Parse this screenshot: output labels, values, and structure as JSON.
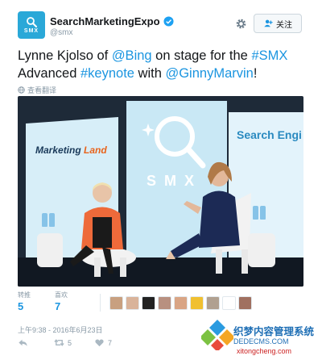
{
  "header": {
    "display_name": "SearchMarketingExpo",
    "handle": "@smx",
    "avatar_text": "SMX",
    "follow_label": "关注"
  },
  "tweet": {
    "part1": "Lynne Kjolso of ",
    "mention_bing": "@Bing",
    "part2": " on stage for the ",
    "hashtag_smx": "#SMX",
    "part3": "Advanced ",
    "hashtag_keynote": "#keynote",
    "part4": " with ",
    "mention_ginny": "@GinnyMarvin",
    "part5": "!",
    "translate_label": "查看翻译"
  },
  "photo": {
    "banner_left_text1": "Marketing",
    "banner_left_text2": "Land",
    "banner_mid_text": "SMX",
    "banner_right_text": "Search Engi"
  },
  "stats": {
    "retweets_label": "转推",
    "retweets_value": "5",
    "likes_label": "喜欢",
    "likes_value": "7"
  },
  "likers": [
    {
      "color": "#c8a080"
    },
    {
      "color": "#d9b39a"
    },
    {
      "color": "#222222"
    },
    {
      "color": "#b89080"
    },
    {
      "color": "#d9a585"
    },
    {
      "color": "#f0c030"
    },
    {
      "color": "#b0a090"
    },
    {
      "color": "#ffffff"
    },
    {
      "color": "#a07060"
    }
  ],
  "timestamp": "上午9:38 - 2016年6月23日",
  "actions": {
    "retweet_count": "5",
    "like_count": "7"
  },
  "watermark": {
    "line1": "织梦内容管理系统",
    "line2": "DEDECMS.COM",
    "line3": "xitongcheng.com"
  },
  "colors": {
    "link": "#1b95e0",
    "brand": "#2aa8d8",
    "muted": "#8899a6"
  }
}
